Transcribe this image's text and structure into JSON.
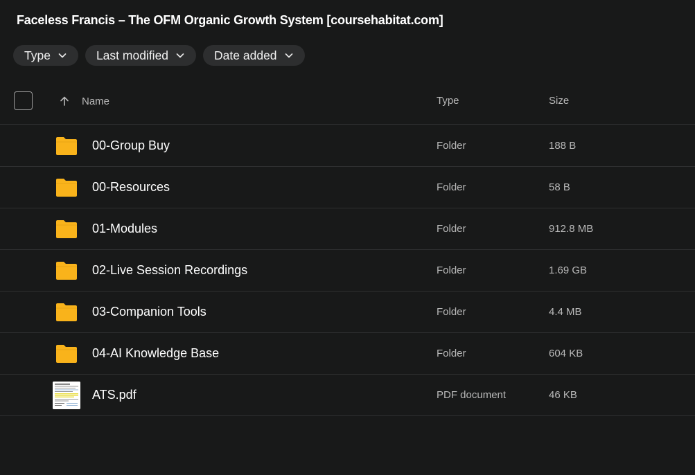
{
  "title": "Faceless Francis – The OFM Organic Growth System [coursehabitat.com]",
  "filters": [
    {
      "label": "Type",
      "icon": "chevron-down-icon"
    },
    {
      "label": "Last modified",
      "icon": "chevron-down-icon"
    },
    {
      "label": "Date added",
      "icon": "chevron-down-icon"
    }
  ],
  "columns": {
    "name": "Name",
    "type": "Type",
    "size": "Size",
    "sort_icon": "arrow-up-icon"
  },
  "colors": {
    "background": "#181919",
    "chip": "#2d2e2f",
    "folder": "#f9b31b",
    "divider": "#2f3031"
  },
  "files": [
    {
      "name": "00-Group Buy",
      "type": "Folder",
      "size": "188 B",
      "icon": "folder-icon"
    },
    {
      "name": "00-Resources",
      "type": "Folder",
      "size": "58 B",
      "icon": "folder-icon"
    },
    {
      "name": "01-Modules",
      "type": "Folder",
      "size": "912.8 MB",
      "icon": "folder-icon"
    },
    {
      "name": "02-Live Session Recordings",
      "type": "Folder",
      "size": "1.69 GB",
      "icon": "folder-icon"
    },
    {
      "name": "03-Companion Tools",
      "type": "Folder",
      "size": "4.4 MB",
      "icon": "folder-icon"
    },
    {
      "name": "04-AI Knowledge Base",
      "type": "Folder",
      "size": "604 KB",
      "icon": "folder-icon"
    },
    {
      "name": "ATS.pdf",
      "type": "PDF document",
      "size": "46 KB",
      "icon": "pdf-thumbnail"
    }
  ]
}
